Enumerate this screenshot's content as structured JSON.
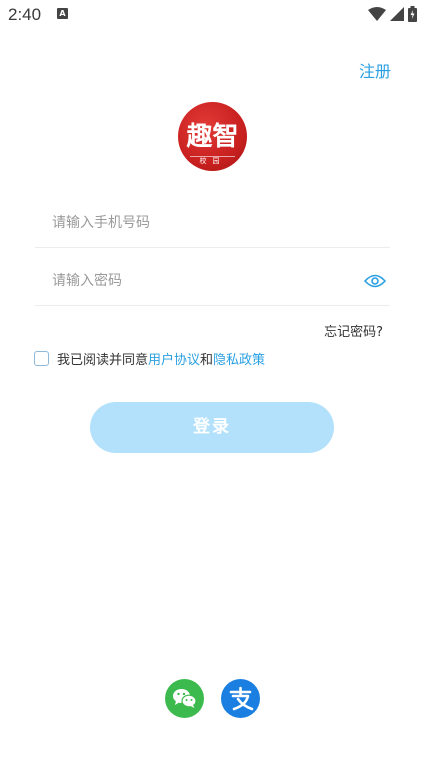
{
  "status_bar": {
    "time": "2:40",
    "badge": "A"
  },
  "header": {
    "register_label": "注册"
  },
  "logo": {
    "title": "趣智",
    "subtitle": "校园"
  },
  "form": {
    "phone_placeholder": "请输入手机号码",
    "password_placeholder": "请输入密码",
    "forgot_password": "忘记密码?"
  },
  "agreement": {
    "prefix": "我已阅读并同意",
    "user_agreement": "用户协议",
    "and": "和",
    "privacy_policy": "隐私政策"
  },
  "login": {
    "label": "登录"
  },
  "social": {
    "items": [
      "wechat-icon",
      "alipay-icon"
    ]
  },
  "colors": {
    "accent": "#2aa0e2",
    "button": "#b3e1fb",
    "logo": "#c8201f",
    "wechat": "#3dba4e",
    "alipay": "#1a7fe0"
  }
}
